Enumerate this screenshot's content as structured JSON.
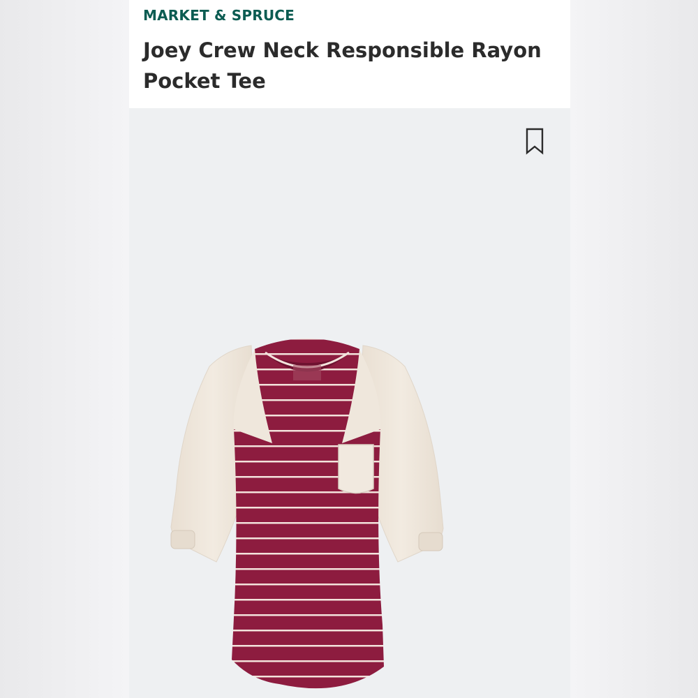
{
  "product": {
    "brand": "MARKET & SPRUCE",
    "title": "Joey Crew Neck Responsible Rayon Pocket Tee"
  },
  "colors": {
    "brand_text": "#0c5c52",
    "title_text": "#2b2b2b",
    "shirt_body": "#8d1c3f",
    "shirt_stripe": "#f3e3dc",
    "sleeve": "#efe7dc"
  },
  "icons": {
    "save": "bookmark-icon"
  }
}
